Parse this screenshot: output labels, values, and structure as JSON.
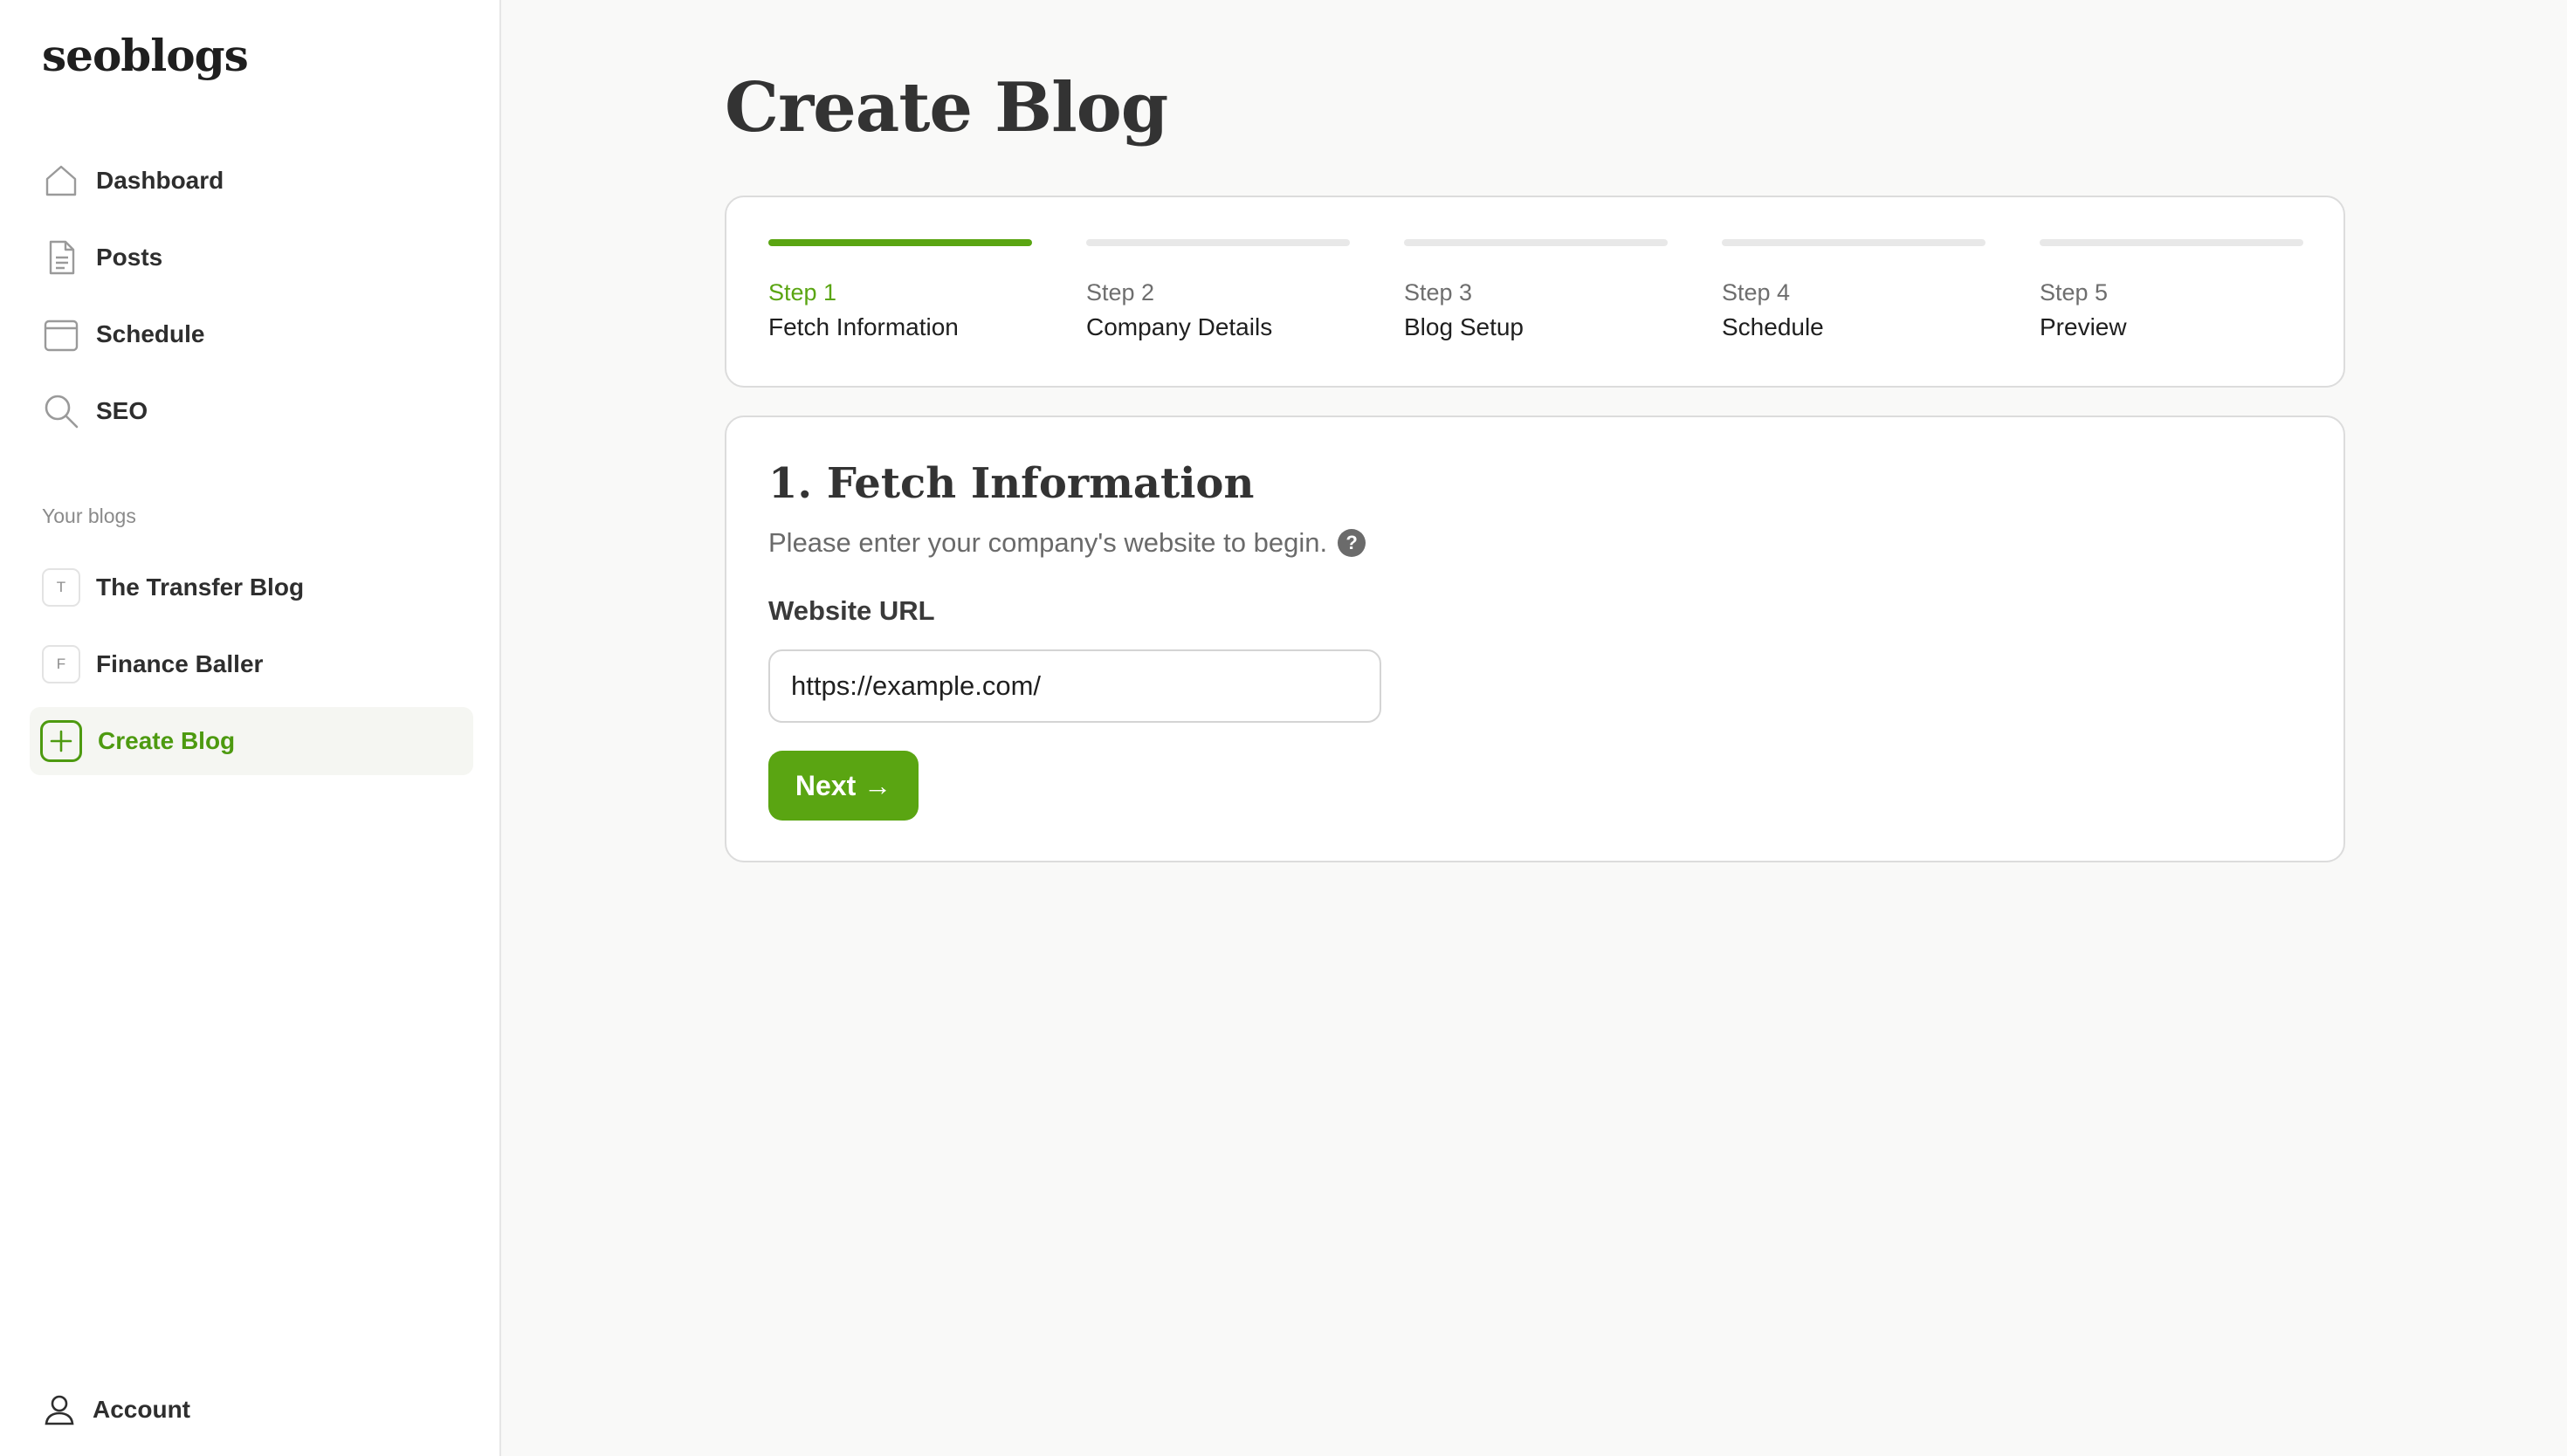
{
  "brand": "seoblogs",
  "nav": [
    {
      "label": "Dashboard",
      "icon": "home-icon"
    },
    {
      "label": "Posts",
      "icon": "document-icon"
    },
    {
      "label": "Schedule",
      "icon": "calendar-icon"
    },
    {
      "label": "SEO",
      "icon": "search-icon"
    }
  ],
  "blogs_section": {
    "title": "Your blogs",
    "items": [
      {
        "initial": "T",
        "label": "The Transfer Blog"
      },
      {
        "initial": "F",
        "label": "Finance Baller"
      }
    ],
    "create_label": "Create Blog"
  },
  "account": {
    "label": "Account",
    "icon": "user-icon"
  },
  "page_title": "Create Blog",
  "steps": [
    {
      "number": "Step 1",
      "name": "Fetch Information",
      "active": true
    },
    {
      "number": "Step 2",
      "name": "Company Details",
      "active": false
    },
    {
      "number": "Step 3",
      "name": "Blog Setup",
      "active": false
    },
    {
      "number": "Step 4",
      "name": "Schedule",
      "active": false
    },
    {
      "number": "Step 5",
      "name": "Preview",
      "active": false
    }
  ],
  "form": {
    "title": "1. Fetch Information",
    "subtitle": "Please enter your company's website to begin.",
    "help_symbol": "?",
    "field_label": "Website URL",
    "url_value": "https://example.com/",
    "next_label": "Next →"
  },
  "colors": {
    "accent": "#5aa512",
    "accent_text": "#4d9a10",
    "background": "#f9f9f8",
    "sidebar": "#ffffff"
  }
}
